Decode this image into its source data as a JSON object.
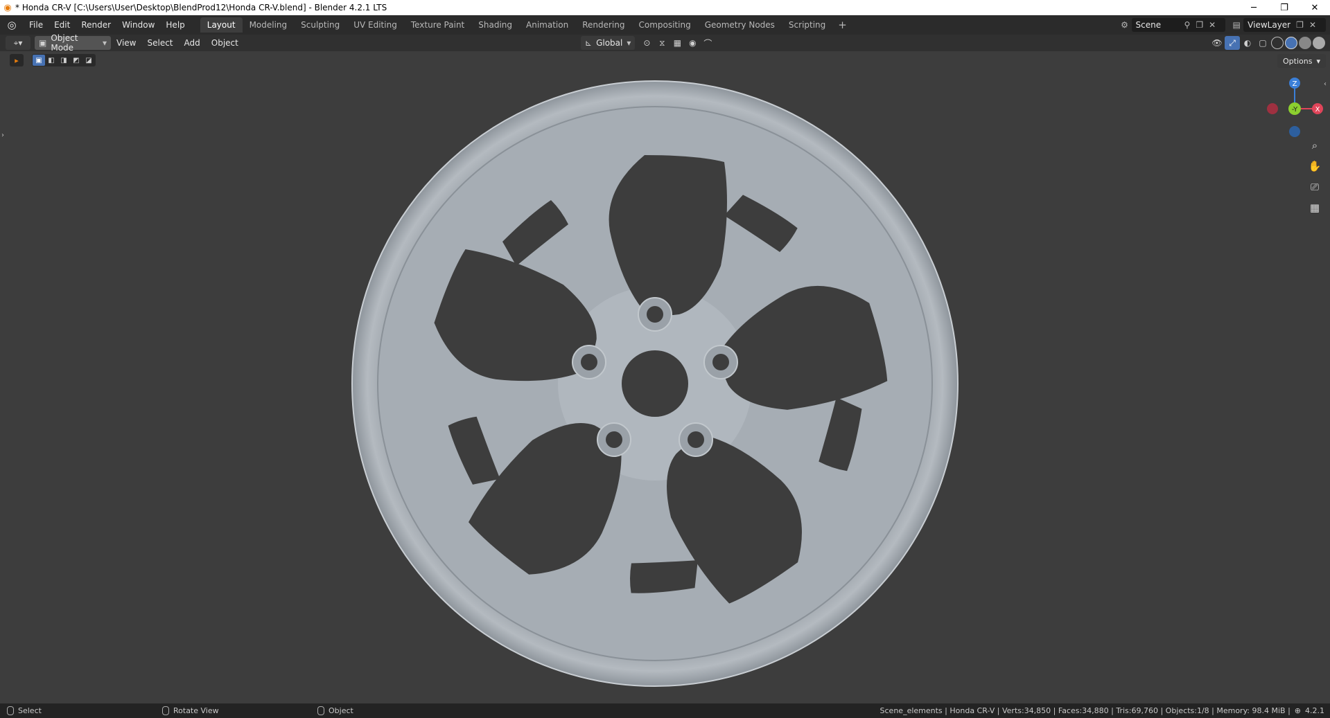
{
  "window": {
    "title": "* Honda CR-V [C:\\Users\\User\\Desktop\\BlendProd12\\Honda CR-V.blend] - Blender 4.2.1 LTS",
    "min_glyph": "─",
    "max_glyph": "❐",
    "close_glyph": "✕"
  },
  "menu": [
    "File",
    "Edit",
    "Render",
    "Window",
    "Help"
  ],
  "workspaces": [
    "Layout",
    "Modeling",
    "Sculpting",
    "UV Editing",
    "Texture Paint",
    "Shading",
    "Animation",
    "Rendering",
    "Compositing",
    "Geometry Nodes",
    "Scripting"
  ],
  "active_workspace": "Layout",
  "add_workspace": "+",
  "scene": {
    "label": "Scene",
    "view_layer": "ViewLayer"
  },
  "header": {
    "mode": "Object Mode",
    "menus": [
      "View",
      "Select",
      "Add",
      "Object"
    ],
    "orientation": "Global"
  },
  "options_label": "Options",
  "gizmo": {
    "z": "Z",
    "y": "-Y",
    "x": "X"
  },
  "status": {
    "select": "Select",
    "rotate": "Rotate View",
    "object": "Object",
    "stats": "Scene_elements | Honda CR-V | Verts:34,850 | Faces:34,880 | Tris:69,760 | Objects:1/8 | Memory: 98.4 MiB |",
    "version": "4.2.1"
  },
  "colors": {
    "accent": "#4772b3",
    "axis_x": "#e0455a",
    "axis_y": "#8ccf2f",
    "axis_z": "#3b7fd8",
    "wheel": "#a9b0b7",
    "viewport_bg": "#3d3d3d"
  }
}
